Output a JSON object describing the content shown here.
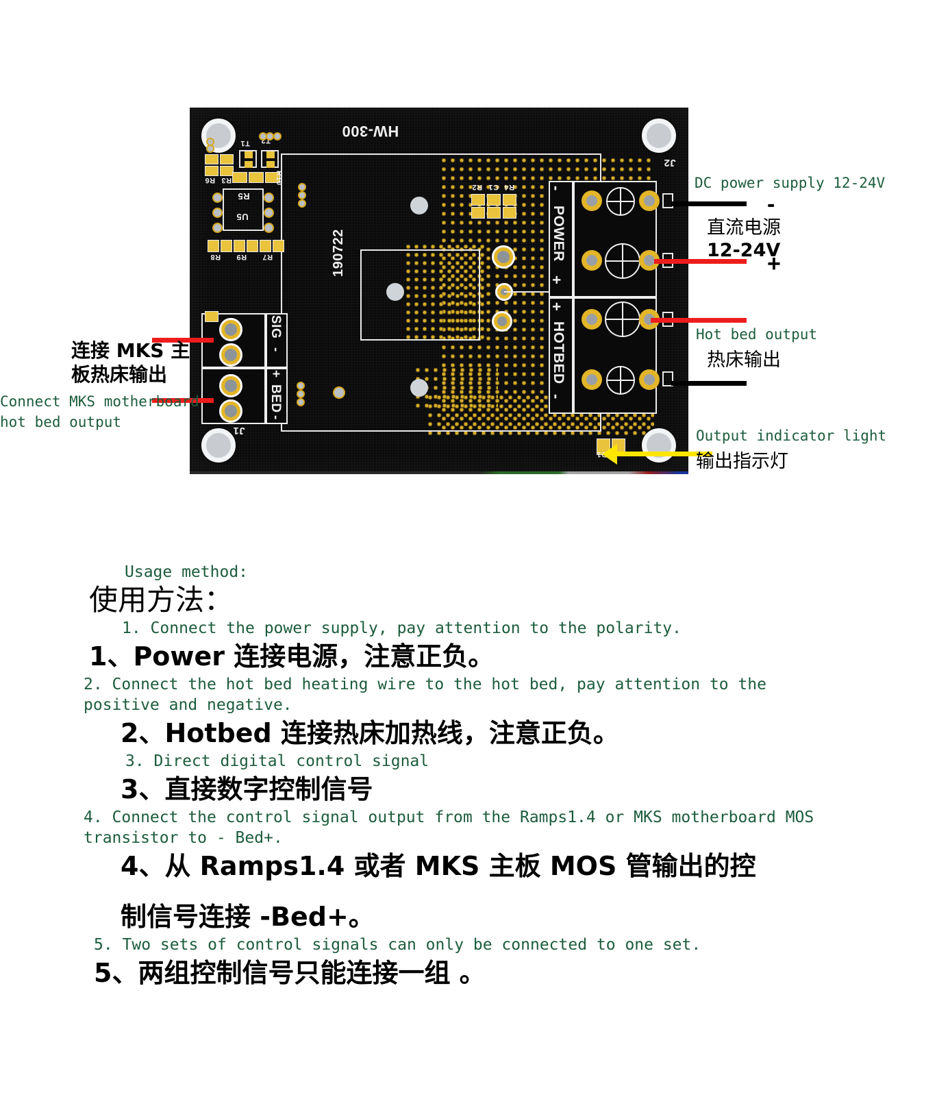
{
  "figure": {
    "board_silk": {
      "model": "HW-300",
      "date_code": "190722",
      "connector_j1": "J1",
      "connector_j2": "J2",
      "sig_label": "SIG",
      "minus_1": "-",
      "plus_1": "+",
      "bed_label": "BED",
      "minus_2": "-",
      "power_label": "POWER",
      "power_minus": "-",
      "power_plus": "+",
      "hotbed_label": "HOTBED",
      "hotbed_plus": "+",
      "hotbed_minus": "-",
      "refs": [
        "R6",
        "R3",
        "T1",
        "T2",
        "R10",
        "R5",
        "U5",
        "R8",
        "R9",
        "R7",
        "R2",
        "C1",
        "R4",
        "D1"
      ]
    },
    "annotations": {
      "dc_power_en": "DC power supply 12-24V",
      "dc_power_cn": "直流电源",
      "dc_power_voltage": "12-24V",
      "polarity_minus": "-",
      "polarity_plus": "+",
      "hotbed_out_en": "Hot bed output",
      "hotbed_out_cn": "热床输出",
      "indicator_en": "Output indicator light",
      "indicator_cn": "输出指示灯",
      "mks_cn_line1": "连接 MKS 主",
      "mks_cn_line2": "板热床输出",
      "mks_en_line1": "Connect MKS motherboard",
      "mks_en_line2": "hot bed output"
    },
    "colors": {
      "annotation_green": "#1c5c3c",
      "leader_black": "#000000",
      "leader_red": "#ee1c1c",
      "leader_yellow": "#ffe600",
      "pcb_black": "#0b0b0b",
      "copper_gold": "#e3b528",
      "silkscreen_white": "#efefef"
    }
  },
  "usage": {
    "heading_en": "Usage method:",
    "heading_cn": "使用方法：",
    "steps": [
      {
        "en": "1. Connect the power supply, pay attention to the polarity.",
        "cn": "1、Power 连接电源，注意正负。"
      },
      {
        "en": "2. Connect the hot bed heating wire to the hot bed, pay attention to the",
        "en2": "positive and negative.",
        "cn": "2、Hotbed 连接热床加热线，注意正负。"
      },
      {
        "en": "3. Direct digital control signal",
        "cn": "3、直接数字控制信号"
      },
      {
        "en": "4. Connect the control signal output from the Ramps1.4 or MKS motherboard MOS",
        "en2": "transistor to - Bed+.",
        "cn": "4、从 Ramps1.4 或者 MKS 主板 MOS 管输出的控",
        "cn2": "制信号连接 -Bed+。"
      },
      {
        "en": "5. Two sets of control signals can only be connected to one set.",
        "cn": "5、两组控制信号只能连接一组 。"
      }
    ]
  }
}
